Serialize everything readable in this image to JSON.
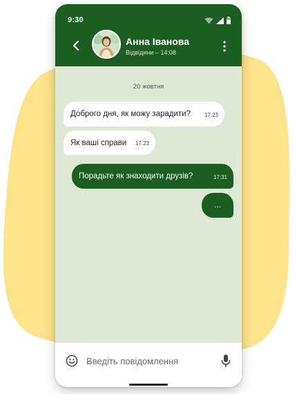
{
  "status": {
    "time": "9:30"
  },
  "header": {
    "name": "Анна Іванова",
    "last_seen": "Відвідини – 14:08"
  },
  "chat": {
    "date": "20 жовтня",
    "messages": [
      {
        "direction": "incoming",
        "text": "Доброго дня, як можу зарадити?",
        "time": "17:23"
      },
      {
        "direction": "incoming",
        "text": "Як ваші справи",
        "time": "17:23"
      },
      {
        "direction": "outgoing",
        "text": "Порадьте як знаходити друзів?",
        "time": "17:31"
      },
      {
        "direction": "outgoing",
        "text": "...",
        "time": ""
      }
    ]
  },
  "composer": {
    "placeholder": "Введіть повідомлення"
  },
  "colors": {
    "brand": "#1b5e20",
    "chat_bg": "#dfe8d5",
    "blob": "#fde38a"
  },
  "icons": [
    "back-arrow-icon",
    "kebab-menu-icon",
    "emoji-icon",
    "mic-icon",
    "wifi-icon",
    "signal-icon",
    "battery-icon"
  ]
}
